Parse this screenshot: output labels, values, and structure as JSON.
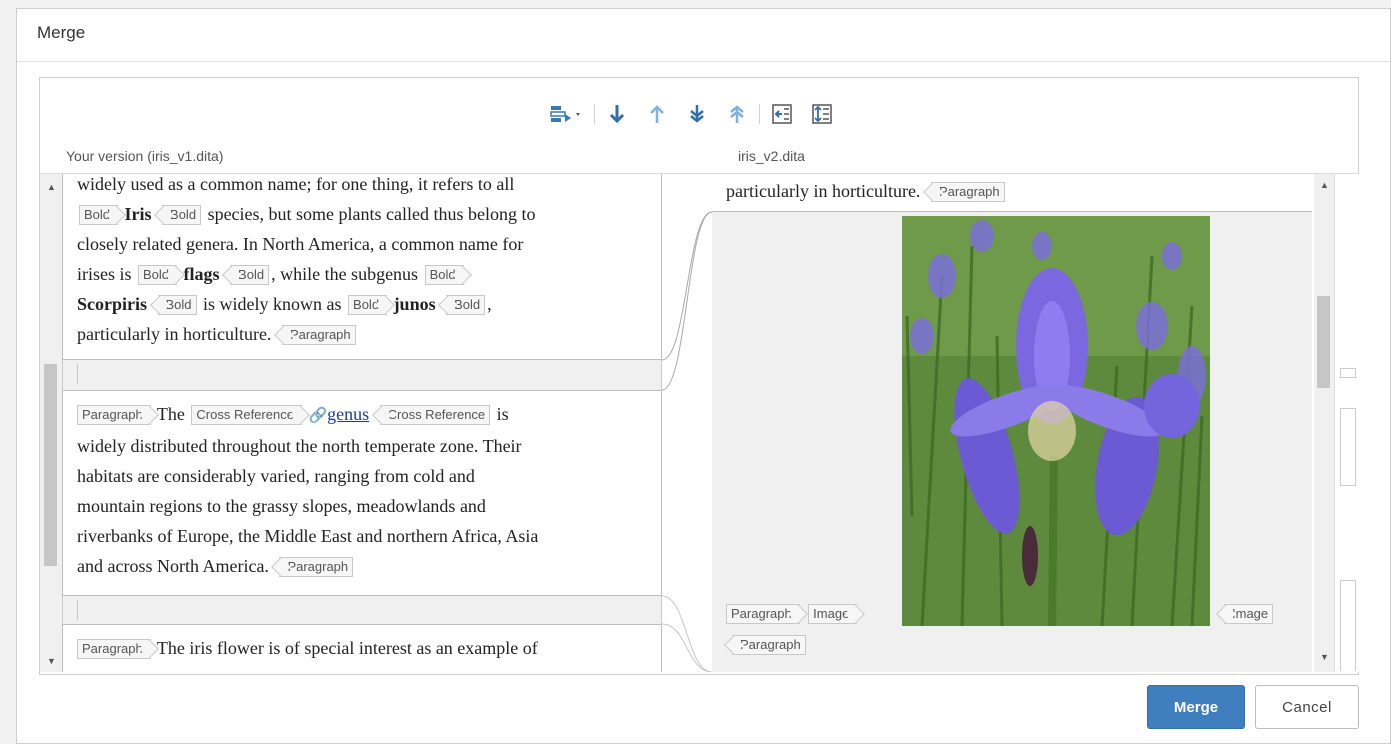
{
  "dialog": {
    "title": "Merge"
  },
  "headers": {
    "left": "Your version (iris_v1.dita)",
    "right": "iris_v2.dita"
  },
  "toolbar": {
    "icons": [
      "merge-mode-icon",
      "next-change-icon",
      "previous-change-icon",
      "last-change-icon",
      "first-change-icon",
      "accept-left-icon",
      "accept-all-icon"
    ]
  },
  "left": {
    "block1": {
      "line1": "widely used as a common name; for one thing, it refers to all",
      "tag_bold": "Bold",
      "iris": "Iris",
      "after_iris": "species, but some plants called thus belong to",
      "line3": "closely related genera. In North America, a common name for",
      "irises_is": "irises is",
      "flags": "flags",
      "while_sub": ", while the subgenus",
      "scorpiris": "Scorpiris",
      "widely_known": "is widely known as",
      "junos": "junos",
      "comma": ",",
      "horticulture": "particularly in horticulture.",
      "tag_paragraph": "Paragraph"
    },
    "block2": {
      "tag_paragraph": "Paragraph",
      "the": "The",
      "tag_xref": "Cross Reference",
      "link": "genus",
      "is": "is",
      "line2": "widely distributed throughout the north temperate zone. Their",
      "line3": "habitats are considerably varied, ranging from cold and",
      "line4": "mountain regions to the grassy slopes, meadowlands and",
      "line5": "riverbanks of Europe, the Middle East and northern Africa, Asia",
      "line6": "and across North America."
    },
    "block3": {
      "tag_paragraph": "Paragraph",
      "text": "The iris flower is of special interest as an example of"
    }
  },
  "right": {
    "top_text": "particularly in horticulture.",
    "tag_paragraph": "Paragraph",
    "tag_image": "Image"
  },
  "buttons": {
    "merge": "Merge",
    "cancel": "Cancel"
  }
}
